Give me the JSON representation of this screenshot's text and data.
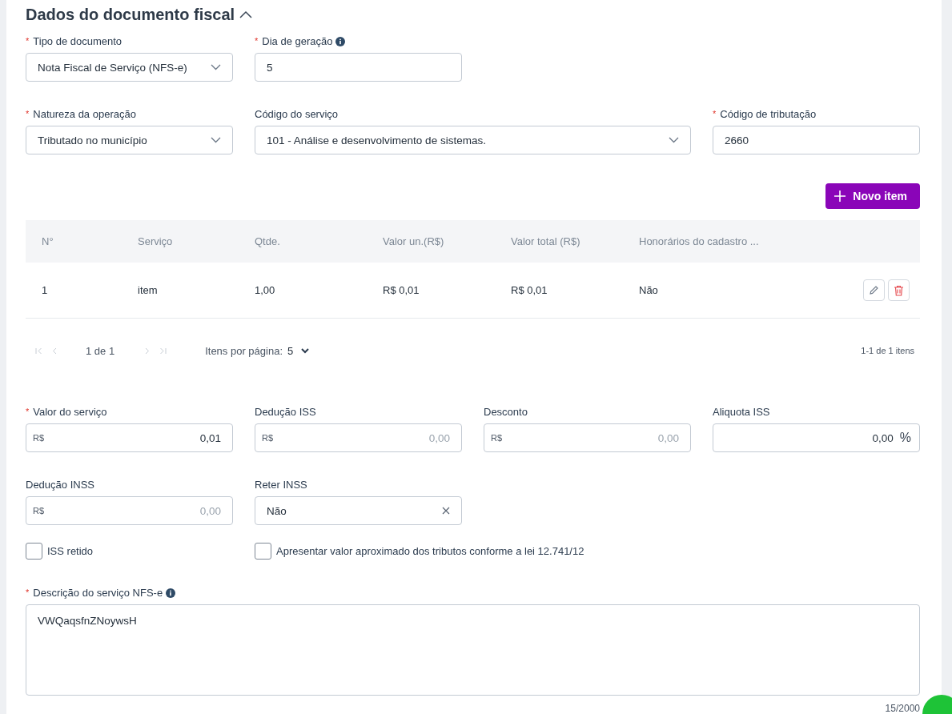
{
  "section": {
    "title": "Dados do documento fiscal",
    "expanded": true
  },
  "field_rows": [
    [
      {
        "kind": "select",
        "required_mark": "*",
        "label": "Tipo de documento",
        "info": false,
        "value": "Nota Fiscal de Serviço (NFS-e)"
      },
      {
        "kind": "text",
        "required_mark": "*",
        "label": "Dia de geração",
        "info": true,
        "value": "5"
      }
    ],
    [
      {
        "kind": "select",
        "required_mark": "*",
        "label": "Natureza da operação",
        "info": false,
        "value": "Tributado no município"
      },
      {
        "kind": "select",
        "label": "Código do serviço",
        "info": false,
        "value": "101 - Análise e desenvolvimento de sistemas."
      },
      {
        "kind": "text",
        "required_mark": "*",
        "label": "Código de tributação",
        "info": false,
        "value": "2660"
      }
    ]
  ],
  "new_item_button": {
    "label": "Novo item"
  },
  "table": {
    "columns": [
      "N°",
      "Serviço",
      "Qtde.",
      "Valor un.(R$)",
      "Valor total (R$)",
      "Honorários do cadastro ..."
    ],
    "rows": [
      {
        "cells": [
          "1",
          "item",
          "1,00",
          "R$ 0,01",
          "R$ 0,01",
          "Não"
        ]
      }
    ]
  },
  "pagination": {
    "page": "1 de 1",
    "per_page_label": "Itens por página:",
    "per_page": "5",
    "range": "1-1 de 1 itens"
  },
  "value_rows": [
    [
      {
        "kind": "money",
        "required_mark": "*",
        "label": "Valor do serviço",
        "info": false,
        "prefix": "R$",
        "value": "0,01"
      },
      {
        "kind": "money",
        "label": "Dedução ISS",
        "info": false,
        "prefix": "R$",
        "placeholder": "0,00"
      },
      {
        "kind": "money",
        "label": "Desconto",
        "info": false,
        "prefix": "R$",
        "placeholder": "0,00"
      },
      {
        "kind": "percent",
        "label": "Aliquota ISS",
        "info": false,
        "value": "0,00",
        "suffix": "%"
      }
    ],
    [
      {
        "kind": "money",
        "label": "Dedução INSS",
        "info": false,
        "prefix": "R$",
        "placeholder": "0,00"
      },
      {
        "kind": "clearable",
        "label": "Reter INSS",
        "info": false,
        "value": "Não"
      }
    ]
  ],
  "checkboxes": [
    {
      "label": "ISS retido",
      "checked": false
    },
    {
      "label": "Apresentar valor aproximado dos tributos conforme a lei 12.741/12",
      "checked": false
    }
  ],
  "description": {
    "required_mark": "*",
    "label": "Descrição do serviço NFS-e",
    "info": true,
    "value": "VWQaqsfnZNoywsH",
    "counter": "15/2000"
  }
}
